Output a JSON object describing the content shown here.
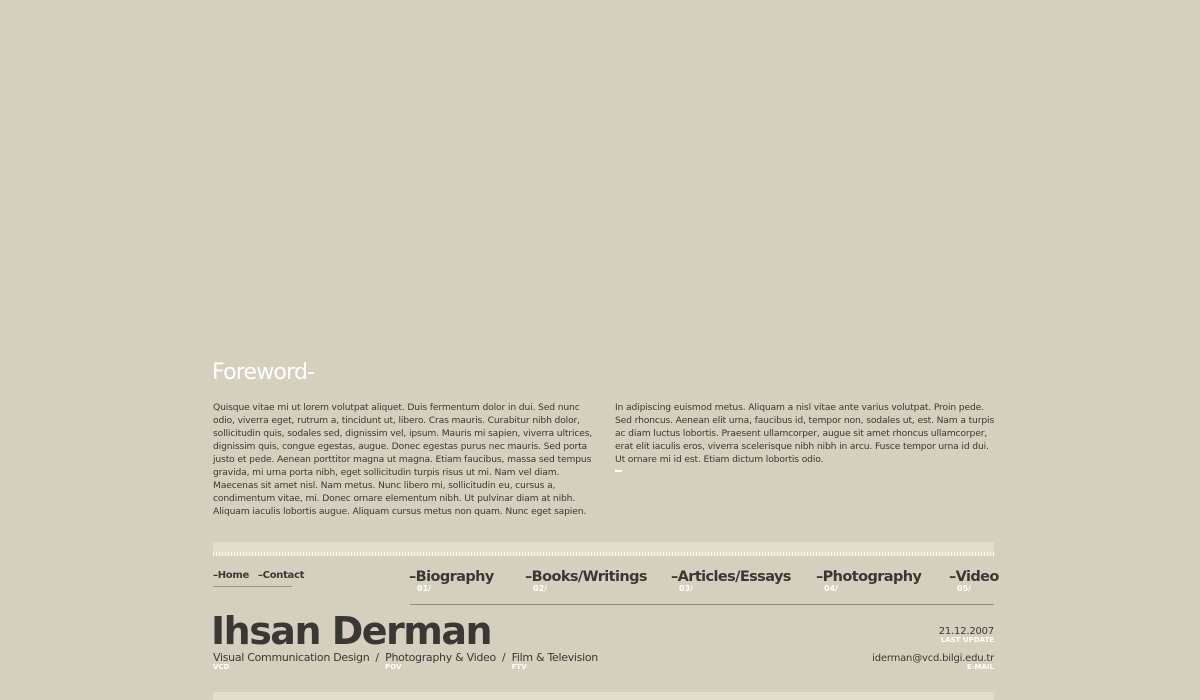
{
  "foreword": {
    "title": "Foreword-",
    "left_text": "Quisque vitae mi ut lorem volutpat aliquet. Duis fermentum dolor in dui. Sed nunc odio, viverra eget, rutrum a, tincidunt ut, libero. Cras mauris. Curabitur nibh dolor, sollicitudin quis, sodales sed, dignissim vel, ipsum. Mauris mi sapien, viverra ultrices, dignissim quis, congue egestas, augue. Donec egestas purus nec mauris. Sed porta justo et pede. Aenean porttitor magna ut magna. Etiam faucibus, massa sed tempus gravida, mi urna porta nibh, eget sollicitudin turpis risus ut mi. Nam vel diam. Maecenas sit amet nisl. Nam metus. Nunc libero mi, sollicitudin eu, cursus a, condimentum vitae, mi. Donec ornare elementum nibh. Ut pulvinar diam at nibh. Aliquam iaculis lobortis augue. Aliquam cursus metus non quam. Nunc eget sapien.",
    "right_text": "In adipiscing euismod metus. Aliquam a nisl vitae ante varius volutpat. Proin pede. Sed rhoncus. Aenean elit urna, faucibus id, tempor non, sodales ut, est. Nam a turpis ac diam luctus lobortis. Praesent ullamcorper, augue sit amet rhoncus ullamcorper, erat elit iaculis eros, viverra scelerisque nibh nibh in arcu. Fusce tempor urna id dui. Ut ornare mi id est. Etiam dictum lobortis odio."
  },
  "util_nav": {
    "home": "–Home",
    "contact": "–Contact"
  },
  "main_nav": [
    {
      "label": "–Biography",
      "num": "01/"
    },
    {
      "label": "–Books/Writings",
      "num": "02/"
    },
    {
      "label": "–Articles/Essays",
      "num": "03/"
    },
    {
      "label": "–Photography",
      "num": "04/"
    },
    {
      "label": "–Video",
      "num": "05/"
    }
  ],
  "site_name": "Ihsan Derman",
  "departments": [
    {
      "name": "Visual Communication Design",
      "abbr": "VCD"
    },
    {
      "name": "Photography & Video",
      "abbr": "POV"
    },
    {
      "name": "Film & Television",
      "abbr": "FTV"
    }
  ],
  "separator": "/",
  "meta": {
    "date": "21.12.2007",
    "date_label": "LAST UPDATE",
    "email": "iderman@vcd.bilgi.edu.tr",
    "email_label": "E-MAIL"
  }
}
